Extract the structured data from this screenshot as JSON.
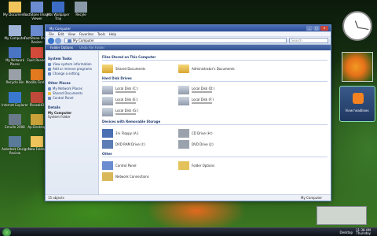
{
  "desktop_icons": [
    {
      "label": "My Documents"
    },
    {
      "label": "FastStone Image Viewer"
    },
    {
      "label": "Alts Wallpaper Tray"
    },
    {
      "label": "Recyle"
    },
    {
      "label": "My Computer"
    },
    {
      "label": "FastStone Photo Resizer"
    },
    {
      "label": "My Network Places"
    },
    {
      "label": "Foxit Reader"
    },
    {
      "label": "Recycle Bin"
    },
    {
      "label": "Mozilla Firefox"
    },
    {
      "label": "Internet Explorer"
    },
    {
      "label": "PicasaHD"
    },
    {
      "label": "EmuXe 2008"
    },
    {
      "label": "Ap-Desktop"
    },
    {
      "label": "Autodesk Design Review"
    },
    {
      "label": "New Folder"
    }
  ],
  "window": {
    "title": "My Computer",
    "menu": [
      "File",
      "Edit",
      "View",
      "Favorites",
      "Tools",
      "Help"
    ],
    "address": "My Computer",
    "search_placeholder": "Search",
    "cmd": [
      "Folder Options",
      "Undo File Folder"
    ],
    "side": {
      "tasks_title": "System Tasks",
      "tasks": [
        "View system information",
        "Add or remove programs",
        "Change a setting"
      ],
      "places_title": "Other Places",
      "places": [
        "My Network Places",
        "Shared Documents",
        "Control Panel"
      ],
      "details_title": "Details",
      "details_name": "My Computer",
      "details_type": "System Folder"
    },
    "sections": {
      "stored": "Files Stored on This Computer",
      "hdd": "Hard Disk Drives",
      "removable": "Devices with Removable Storage",
      "other": "Other"
    },
    "stored_items": [
      "Shared Documents",
      "Administrator's Documents"
    ],
    "drives": [
      {
        "label": "Local Disk (C:)",
        "fill": 0.35
      },
      {
        "label": "Local Disk (D:)",
        "fill": 0.6
      },
      {
        "label": "Local Disk (E:)",
        "fill": 0.4
      },
      {
        "label": "Local Disk (F:)",
        "fill": 0.45
      },
      {
        "label": "Local Disk (G:)",
        "fill": 0.5
      }
    ],
    "removable_items": [
      "3½ Floppy (A:)",
      "CD Drive (H:)",
      "DVD RAM Drive (I:)",
      "DVD Drive (J:)"
    ],
    "other_items": [
      "Control Panel",
      "Folder Options",
      "Network Connections"
    ],
    "status_left": "15 objects",
    "status_right": "My Computer"
  },
  "gadgets": {
    "feeds_label": "View headlines"
  },
  "taskbar": {
    "tray_time": "11:38 AM",
    "tray_day": "Thursday",
    "tray_label": "Desktop"
  }
}
